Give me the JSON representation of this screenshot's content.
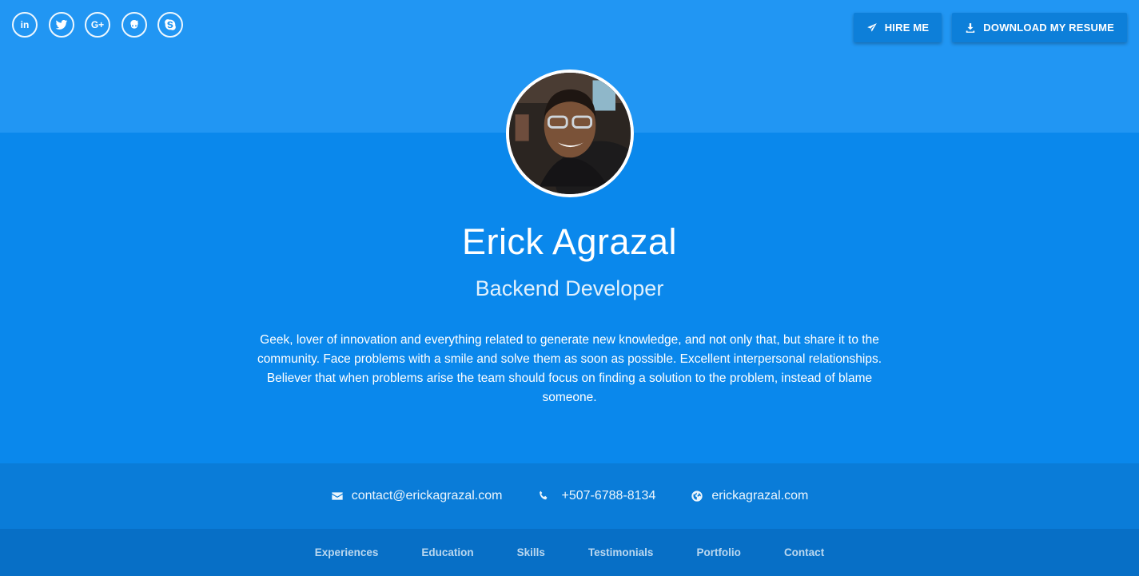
{
  "social": [
    {
      "name": "linkedin-icon",
      "label": "in"
    },
    {
      "name": "twitter-icon",
      "label": ""
    },
    {
      "name": "google-plus-icon",
      "label": "G+"
    },
    {
      "name": "github-icon",
      "label": ""
    },
    {
      "name": "skype-icon",
      "label": ""
    }
  ],
  "header": {
    "hire_label": "HIRE ME",
    "resume_label": "DOWNLOAD MY RESUME"
  },
  "profile": {
    "name": "Erick Agrazal",
    "role": "Backend Developer",
    "bio": "Geek, lover of innovation and everything related to generate new knowledge, and not only that, but share it to the community. Face problems with a smile and solve them as soon as possible. Excellent interpersonal relationships. Believer that when problems arise the team should focus on finding a solution to the problem, instead of blame someone."
  },
  "contact": {
    "email": "contact@erickagrazal.com",
    "phone": "+507-6788-8134",
    "website": "erickagrazal.com"
  },
  "nav": {
    "items": [
      "Experiences",
      "Education",
      "Skills",
      "Testimonials",
      "Portfolio",
      "Contact"
    ]
  },
  "colors": {
    "top_band": "#2196f3",
    "main_band": "#0a88ec",
    "contact_band": "#0a7cd8",
    "nav_band": "#076fc6"
  }
}
